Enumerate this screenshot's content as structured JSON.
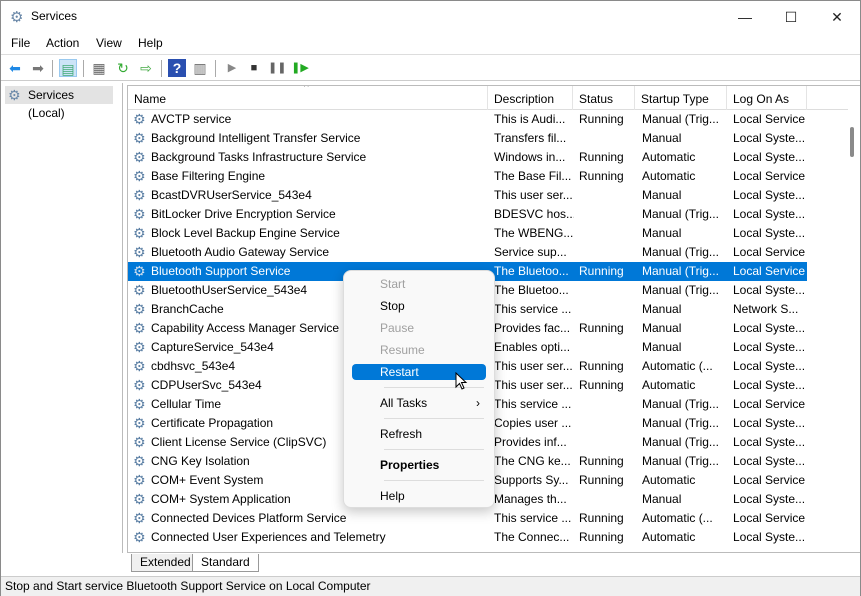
{
  "window": {
    "title": "Services",
    "minimize": "—",
    "maximize": "☐",
    "close": "✕"
  },
  "menu": [
    "File",
    "Action",
    "View",
    "Help"
  ],
  "toolbar": [
    "back-icon",
    "forward-icon",
    "show-hide-console-tree-icon",
    "properties-icon",
    "refresh-icon",
    "export-list-icon",
    "help-icon",
    "show-action-pane-icon",
    "start-service-icon",
    "stop-service-icon",
    "pause-service-icon",
    "restart-service-icon"
  ],
  "tree": {
    "label": "Services (Local)"
  },
  "columns": [
    "Name",
    "Description",
    "Status",
    "Startup Type",
    "Log On As"
  ],
  "rows": [
    [
      "AVCTP service",
      "This is Audi...",
      "Running",
      "Manual (Trig...",
      "Local Service"
    ],
    [
      "Background Intelligent Transfer Service",
      "Transfers fil...",
      "",
      "Manual",
      "Local Syste..."
    ],
    [
      "Background Tasks Infrastructure Service",
      "Windows in...",
      "Running",
      "Automatic",
      "Local Syste..."
    ],
    [
      "Base Filtering Engine",
      "The Base Fil...",
      "Running",
      "Automatic",
      "Local Service"
    ],
    [
      "BcastDVRUserService_543e4",
      "This user ser...",
      "",
      "Manual",
      "Local Syste..."
    ],
    [
      "BitLocker Drive Encryption Service",
      "BDESVC hos...",
      "",
      "Manual (Trig...",
      "Local Syste..."
    ],
    [
      "Block Level Backup Engine Service",
      "The WBENG...",
      "",
      "Manual",
      "Local Syste..."
    ],
    [
      "Bluetooth Audio Gateway Service",
      "Service sup...",
      "",
      "Manual (Trig...",
      "Local Service"
    ],
    [
      "Bluetooth Support Service",
      "The Bluetoo...",
      "Running",
      "Manual (Trig...",
      "Local Service"
    ],
    [
      "BluetoothUserService_543e4",
      "The Bluetoo...",
      "",
      "Manual (Trig...",
      "Local Syste..."
    ],
    [
      "BranchCache",
      "This service ...",
      "",
      "Manual",
      "Network S..."
    ],
    [
      "Capability Access Manager Service",
      "Provides fac...",
      "Running",
      "Manual",
      "Local Syste..."
    ],
    [
      "CaptureService_543e4",
      "Enables opti...",
      "",
      "Manual",
      "Local Syste..."
    ],
    [
      "cbdhsvc_543e4",
      "This user ser...",
      "Running",
      "Automatic (...",
      "Local Syste..."
    ],
    [
      "CDPUserSvc_543e4",
      "This user ser...",
      "Running",
      "Automatic",
      "Local Syste..."
    ],
    [
      "Cellular Time",
      "This service ...",
      "",
      "Manual (Trig...",
      "Local Service"
    ],
    [
      "Certificate Propagation",
      "Copies user ...",
      "",
      "Manual (Trig...",
      "Local Syste..."
    ],
    [
      "Client License Service (ClipSVC)",
      "Provides inf...",
      "",
      "Manual (Trig...",
      "Local Syste..."
    ],
    [
      "CNG Key Isolation",
      "The CNG ke...",
      "Running",
      "Manual (Trig...",
      "Local Syste..."
    ],
    [
      "COM+ Event System",
      "Supports Sy...",
      "Running",
      "Automatic",
      "Local Service"
    ],
    [
      "COM+ System Application",
      "Manages th...",
      "",
      "Manual",
      "Local Syste..."
    ],
    [
      "Connected Devices Platform Service",
      "This service ...",
      "Running",
      "Automatic (...",
      "Local Service"
    ],
    [
      "Connected User Experiences and Telemetry",
      "The Connec...",
      "Running",
      "Automatic",
      "Local Syste..."
    ]
  ],
  "selected_row": 8,
  "context_menu": [
    {
      "label": "Start",
      "state": "disabled"
    },
    {
      "label": "Stop",
      "state": "enabled"
    },
    {
      "label": "Pause",
      "state": "disabled"
    },
    {
      "label": "Resume",
      "state": "disabled"
    },
    {
      "label": "Restart",
      "state": "highlighted"
    },
    {
      "label": "All Tasks",
      "state": "submenu"
    },
    {
      "label": "Refresh",
      "state": "enabled"
    },
    {
      "label": "Properties",
      "state": "bold"
    },
    {
      "label": "Help",
      "state": "enabled"
    }
  ],
  "tabs": [
    "Extended",
    "Standard"
  ],
  "active_tab": "Standard",
  "status_bar": "Stop and Start service Bluetooth Support Service on Local Computer",
  "colors": {
    "selection": "#0078d7"
  }
}
